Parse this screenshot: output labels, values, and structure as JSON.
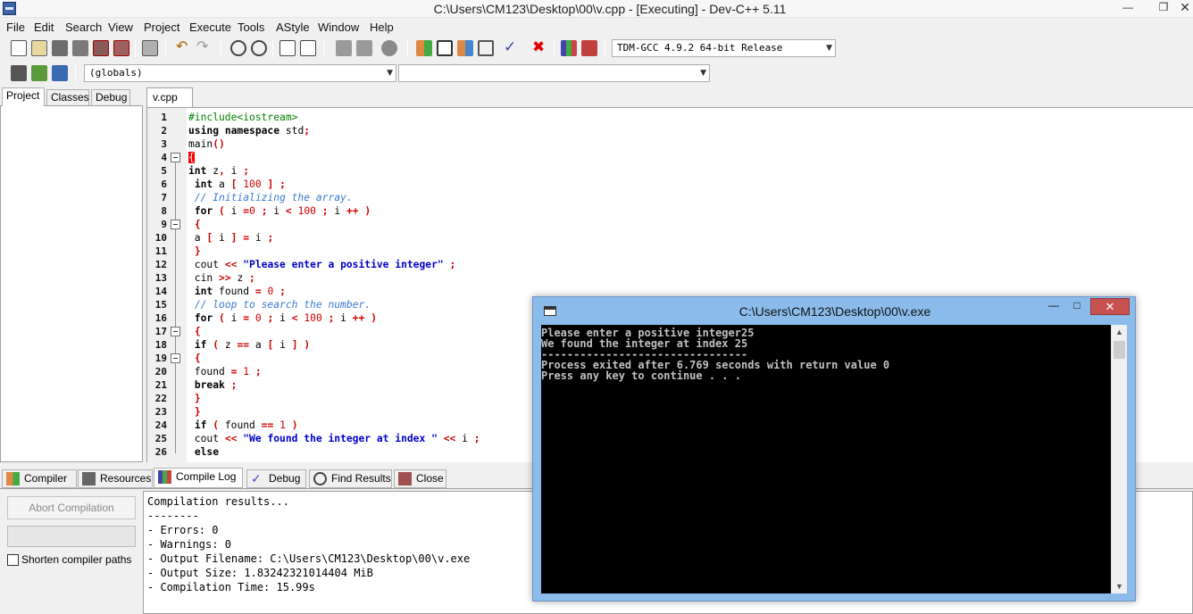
{
  "window": {
    "title": "C:\\Users\\CM123\\Desktop\\00\\v.cpp - [Executing] - Dev-C++ 5.11"
  },
  "menu": [
    "File",
    "Edit",
    "Search",
    "View",
    "Project",
    "Execute",
    "Tools",
    "AStyle",
    "Window",
    "Help"
  ],
  "toolbar": {
    "compiler_select": "TDM-GCC 4.9.2 64-bit Release",
    "scope_select": "(globals)",
    "member_select": ""
  },
  "left_tabs": [
    "Project",
    "Classes",
    "Debug"
  ],
  "editor": {
    "tab": "v.cpp",
    "line_numbers": [
      "1",
      "2",
      "3",
      "4",
      "5",
      "6",
      "7",
      "8",
      "9",
      "10",
      "11",
      "12",
      "13",
      "14",
      "15",
      "16",
      "17",
      "18",
      "19",
      "20",
      "21",
      "22",
      "23",
      "24",
      "25",
      "26"
    ],
    "lines": [
      "#include<iostream>",
      "using namespace std;",
      "main()",
      "{",
      "int z, i ;",
      " int a [ 100 ] ;",
      " // Initializing the array.",
      " for ( i =0 ; i < 100 ; i ++ )",
      " {",
      " a [ i ] = i ;",
      " }",
      " cout << \"Please enter a positive integer\" ;",
      " cin >> z ;",
      " int found = 0 ;",
      " // loop to search the number.",
      " for ( i = 0 ; i < 100 ; i ++ )",
      " {",
      " if ( z == a [ i ] )",
      " {",
      " found = 1 ;",
      " break ;",
      " }",
      " }",
      " if ( found == 1 )",
      " cout << \"We found the integer at index \" << i ;",
      " else"
    ]
  },
  "bottom_tabs": [
    "Compiler",
    "Resources",
    "Compile Log",
    "Debug",
    "Find Results",
    "Close"
  ],
  "compile_panel": {
    "abort_label": "Abort Compilation",
    "shorten_label": "Shorten compiler paths",
    "log": [
      "Compilation results...",
      "--------",
      "- Errors: 0",
      "- Warnings: 0",
      "- Output Filename: C:\\Users\\CM123\\Desktop\\00\\v.exe",
      "- Output Size: 1.83242321014404 MiB",
      "- Compilation Time: 15.99s"
    ]
  },
  "console": {
    "title": "C:\\Users\\CM123\\Desktop\\00\\v.exe",
    "lines": [
      "Please enter a positive integer25",
      "We found the integer at index 25",
      "--------------------------------",
      "Process exited after 6.769 seconds with return value 0",
      "Press any key to continue . . ."
    ]
  },
  "colors": {
    "keyword": "#000000",
    "symbol": "#d00000",
    "string": "#0000c8",
    "comment": "#3c78d0",
    "preprocessor": "#008000",
    "console_frame": "#8bbbeb",
    "close_button": "#c75050"
  }
}
